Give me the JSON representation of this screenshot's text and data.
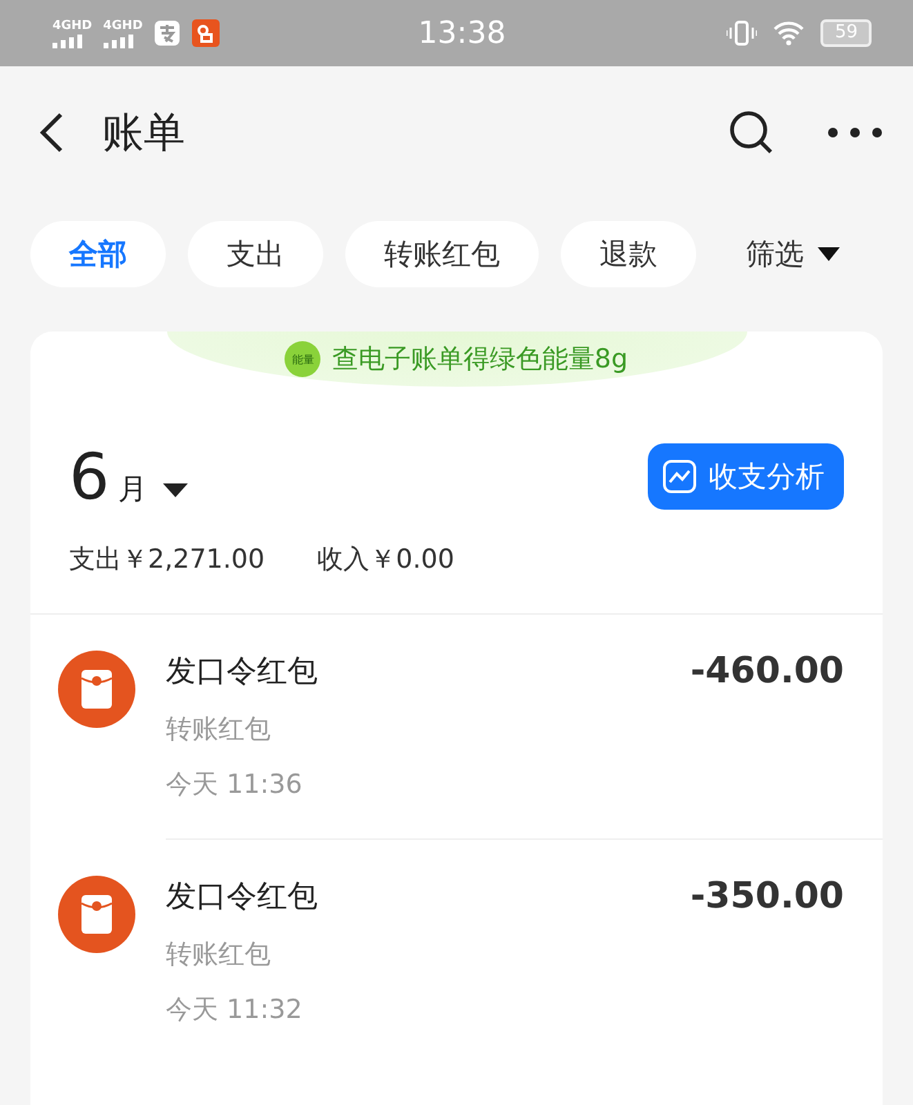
{
  "status_bar": {
    "signals": [
      "4GHD",
      "4GHD"
    ],
    "time": "13:38",
    "battery": "59"
  },
  "header": {
    "title": "账单"
  },
  "tabs": [
    {
      "label": "全部",
      "selected": true
    },
    {
      "label": "支出",
      "selected": false
    },
    {
      "label": "转账红包",
      "selected": false
    },
    {
      "label": "退款",
      "selected": false
    }
  ],
  "filter": {
    "label": "筛选"
  },
  "banner": {
    "badge": "能量",
    "text": "查电子账单得绿色能量8g"
  },
  "summary": {
    "month": "6",
    "month_unit": "月",
    "analysis_button": "收支分析",
    "expense": "支出￥2,271.00",
    "income": "收入￥0.00"
  },
  "transactions": [
    {
      "title": "发口令红包",
      "category": "转账红包",
      "time": "今天 11:36",
      "amount": "-460.00"
    },
    {
      "title": "发口令红包",
      "category": "转账红包",
      "time": "今天 11:32",
      "amount": "-350.00"
    }
  ]
}
